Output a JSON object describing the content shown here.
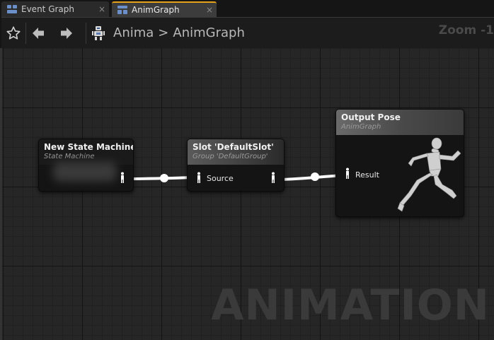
{
  "tabs": [
    {
      "label": "Event Graph",
      "close": "×",
      "icon": "blueprint-graph-icon"
    },
    {
      "label": "AnimGraph",
      "close": "×",
      "icon": "anim-graph-icon"
    }
  ],
  "toolbar": {
    "breadcrumb": {
      "root": "Anima",
      "separator": ">",
      "current": "AnimGraph"
    },
    "zoom": "Zoom -1"
  },
  "graph": {
    "watermark": "ANIMATION",
    "nodes": {
      "state_machine": {
        "title": "New State Machine",
        "subtitle": "State Machine"
      },
      "slot": {
        "title": "Slot 'DefaultSlot'",
        "subtitle": "Group 'DefaultGroup'",
        "input_pin": "Source"
      },
      "output_pose": {
        "title": "Output Pose",
        "subtitle": "AnimGraph",
        "input_pin": "Result"
      }
    }
  },
  "colors": {
    "accent": "#e8a21a",
    "wire": "#ffffff",
    "grid": "#262626"
  }
}
